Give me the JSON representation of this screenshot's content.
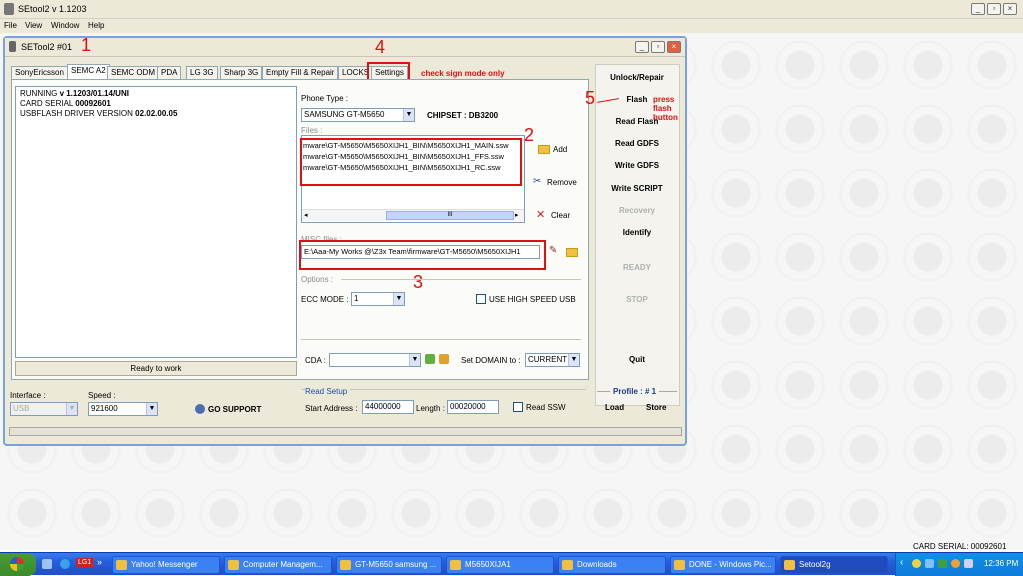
{
  "window": {
    "title": "SEtool2 v 1.1203"
  },
  "menu": [
    "File",
    "View",
    "Window",
    "Help"
  ],
  "child": {
    "title": "SETool2 #01"
  },
  "annotations": {
    "n1": "1",
    "n2": "2",
    "n3": "3",
    "n4": "4",
    "n5": "5",
    "check_sign": "check sign mode only",
    "press_flash": "press flash button"
  },
  "tabs": [
    "SonyEricsson",
    "SEMC A2",
    "SEMC ODM",
    "PDA",
    "LG 3G",
    "Sharp 3G",
    "Empty Fill & Repair",
    "LOCKS",
    "Settings"
  ],
  "log": {
    "line1_label": "RUNNING ",
    "line1_value": "v 1.1203/01.14/UNI",
    "line2_label": "CARD SERIAL ",
    "line2_value": "00092601",
    "line3_label": "USBFLASH DRIVER VERSION ",
    "line3_value": "02.02.00.05",
    "status": "Ready to work"
  },
  "phone": {
    "label": "Phone Type :",
    "value": "SAMSUNG GT-M5650",
    "chipset": "CHIPSET : DB3200"
  },
  "files": {
    "label": "Files :",
    "items": [
      "mware\\GT-M5650\\M5650XIJH1_BIN\\M5650XIJH1_MAIN.ssw",
      "mware\\GT-M5650\\M5650XIJH1_BIN\\M5650XIJH1_FFS.ssw",
      "mware\\GT-M5650\\M5650XIJH1_BIN\\M5650XIJH1_RC.ssw"
    ],
    "add": "Add",
    "remove": "Remove",
    "clear": "Clear",
    "scroll_grip": "III"
  },
  "misc": {
    "label": "MISC files :",
    "value": "E:\\Aaa-My Works @\\Z3x Team\\firmware\\GT-M5650\\M5650XIJH1"
  },
  "options": {
    "label": "Options :",
    "ecc_label": "ECC MODE :",
    "ecc_value": "1",
    "high_speed": "USE HIGH SPEED USB"
  },
  "cda": {
    "label": "CDA :",
    "value": "",
    "domain_label": "Set DOMAIN to :",
    "domain_value": "CURRENT"
  },
  "interface": {
    "label": "Interface :",
    "value": "USB"
  },
  "speed": {
    "label": "Speed :",
    "value": "921600"
  },
  "go_support": "GO SUPPORT",
  "read_setup": {
    "label": "Read Setup",
    "start_label": "Start Address :",
    "start_value": "44000000",
    "length_label": "Length :",
    "length_value": "00020000",
    "read_ssw": "Read SSW"
  },
  "actions": [
    "Unlock/Repair",
    "Flash",
    "Read Flash",
    "Read GDFS",
    "Write GDFS",
    "Write SCRIPT",
    "Recovery",
    "Identify",
    "READY",
    "STOP",
    "Quit"
  ],
  "profile": {
    "label": "Profile : # 1",
    "load": "Load",
    "store": "Store"
  },
  "card_serial_status": "CARD SERIAL: 00092601",
  "taskbar": {
    "items": [
      "Yahoo! Messenger",
      "Computer Managem...",
      "GT-M5650 samsung ...",
      "M5650XIJA1",
      "Downloads",
      "DONE - Windows Pic...",
      "Setool2g"
    ],
    "clock": "12:36 PM",
    "lang": "LG1"
  }
}
